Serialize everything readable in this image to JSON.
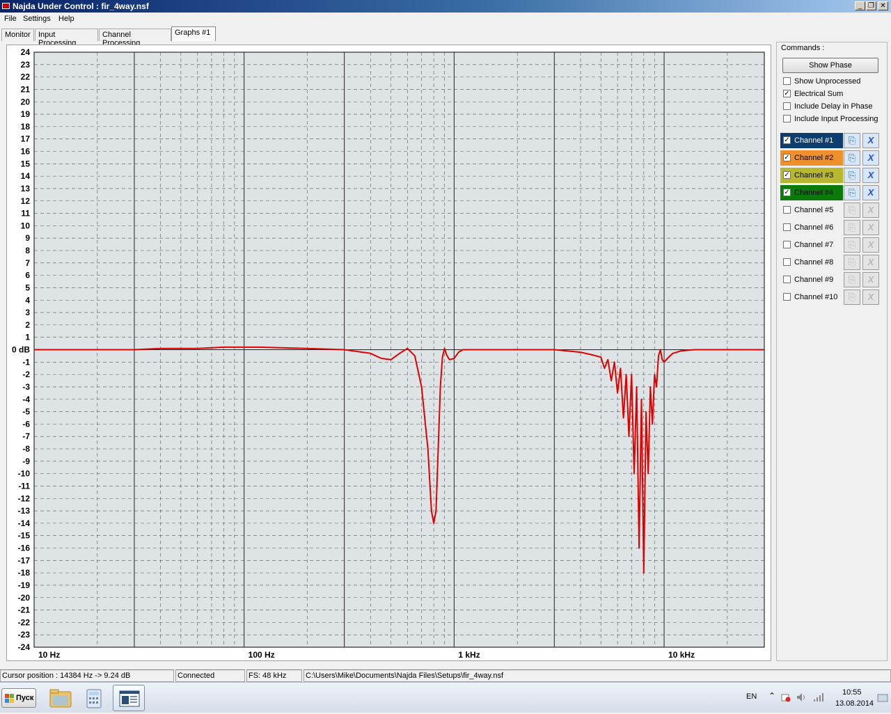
{
  "window": {
    "title": "Najda Under Control : fir_4way.nsf",
    "minimize": "_",
    "restore": "❐",
    "close": "✕"
  },
  "menu": [
    "File",
    "Settings",
    "Help"
  ],
  "tabs": [
    {
      "label": "Monitor",
      "active": false
    },
    {
      "label": "Input Processing",
      "active": false
    },
    {
      "label": "Channel Processing",
      "active": false
    },
    {
      "label": "Graphs #1",
      "active": true
    }
  ],
  "graph": {
    "chart_data": {
      "type": "line",
      "xscale": "log",
      "xlim": [
        10,
        30000
      ],
      "ylim": [
        -24,
        24
      ],
      "ylabel_unit": "dB",
      "yticks": [
        24,
        23,
        22,
        21,
        20,
        19,
        18,
        17,
        16,
        15,
        14,
        13,
        12,
        11,
        10,
        9,
        8,
        7,
        6,
        5,
        4,
        3,
        2,
        1,
        0,
        -1,
        -2,
        -3,
        -4,
        -5,
        -6,
        -7,
        -8,
        -9,
        -10,
        -11,
        -12,
        -13,
        -14,
        -15,
        -16,
        -17,
        -18,
        -19,
        -20,
        -21,
        -22,
        -23,
        -24
      ],
      "ytick_labels": [
        "24",
        "23",
        "22",
        "21",
        "20",
        "19",
        "18",
        "17",
        "16",
        "15",
        "14",
        "13",
        "12",
        "11",
        "10",
        "9",
        "8",
        "7",
        "6",
        "5",
        "4",
        "3",
        "2",
        "1",
        "0 dB",
        "-1",
        "-2",
        "-3",
        "-4",
        "-5",
        "-6",
        "-7",
        "-8",
        "-9",
        "-10",
        "-11",
        "-12",
        "-13",
        "-14",
        "-15",
        "-16",
        "-17",
        "-18",
        "-19",
        "-20",
        "-21",
        "-22",
        "-23",
        "-24"
      ],
      "xticks": [
        {
          "value": 10,
          "label": "10 Hz"
        },
        {
          "value": 100,
          "label": "100 Hz"
        },
        {
          "value": 1000,
          "label": "1 kHz"
        },
        {
          "value": 10000,
          "label": "10 kHz"
        }
      ],
      "grid": true,
      "series": [
        {
          "color": "#e00000",
          "x": [
            10,
            30,
            40,
            60,
            80,
            100,
            120,
            200,
            300,
            400,
            450,
            500,
            550,
            600,
            650,
            700,
            750,
            780,
            800,
            820,
            840,
            860,
            880,
            900,
            920,
            950,
            1000,
            1050,
            1100,
            1200,
            1300,
            1500,
            2000,
            3000,
            4000,
            4500,
            5000,
            5200,
            5400,
            5600,
            5800,
            6000,
            6200,
            6400,
            6600,
            6800,
            7000,
            7200,
            7400,
            7600,
            7800,
            8000,
            8200,
            8400,
            8600,
            8800,
            9000,
            9200,
            9400,
            9600,
            9800,
            10000,
            10500,
            11000,
            12000,
            14000,
            16000,
            20000,
            25000,
            30000
          ],
          "y": [
            0,
            0,
            0.1,
            0.1,
            0.2,
            0.2,
            0.2,
            0.1,
            0,
            -0.3,
            -0.7,
            -0.8,
            -0.3,
            0.1,
            -0.5,
            -3,
            -8,
            -13,
            -14,
            -13,
            -8,
            -3,
            -0.6,
            0.1,
            -0.4,
            -0.8,
            -0.7,
            -0.2,
            0,
            0,
            0,
            0,
            0,
            0,
            -0.2,
            -0.4,
            -0.6,
            -1.5,
            -0.8,
            -2.5,
            -1,
            -3.5,
            -1.5,
            -5.5,
            -2,
            -7,
            -2,
            -10,
            -3,
            -16,
            -4,
            -18,
            -5,
            -10,
            -3,
            -6,
            -2,
            -3,
            -0.5,
            0,
            -0.8,
            -1,
            -0.6,
            -0.3,
            -0.1,
            0,
            0,
            0,
            0,
            0
          ]
        }
      ]
    }
  },
  "commands": {
    "title": "Commands :",
    "show_phase_label": "Show Phase",
    "options": [
      {
        "label": "Show Unprocessed",
        "checked": false
      },
      {
        "label": "Electrical Sum",
        "checked": true
      },
      {
        "label": "Include Delay in Phase",
        "checked": false
      },
      {
        "label": "Include Input Processing",
        "checked": false
      }
    ],
    "channels": [
      {
        "label": "Channel #1",
        "checked": true,
        "color": "#0b3e6e",
        "text_color": "#ffffff",
        "enabled": true
      },
      {
        "label": "Channel #2",
        "checked": true,
        "color": "#f0902a",
        "text_color": "#000000",
        "enabled": true
      },
      {
        "label": "Channel #3",
        "checked": true,
        "color": "#b8b830",
        "text_color": "#000000",
        "enabled": true
      },
      {
        "label": "Channel #4",
        "checked": true,
        "color": "#0a7a0a",
        "text_color": "#000000",
        "enabled": true
      },
      {
        "label": "Channel #5",
        "checked": false,
        "color": "",
        "text_color": "#000000",
        "enabled": false
      },
      {
        "label": "Channel #6",
        "checked": false,
        "color": "",
        "text_color": "#000000",
        "enabled": false
      },
      {
        "label": "Channel #7",
        "checked": false,
        "color": "",
        "text_color": "#000000",
        "enabled": false
      },
      {
        "label": "Channel #8",
        "checked": false,
        "color": "",
        "text_color": "#000000",
        "enabled": false
      },
      {
        "label": "Channel #9",
        "checked": false,
        "color": "",
        "text_color": "#000000",
        "enabled": false
      },
      {
        "label": "Channel #10",
        "checked": false,
        "color": "",
        "text_color": "#000000",
        "enabled": false
      }
    ]
  },
  "status": {
    "cursor": "Cursor position : 14384 Hz -> 9.24 dB",
    "connection": "Connected",
    "fs": "FS: 48 kHz",
    "path": "C:\\Users\\Mike\\Documents\\Najda Files\\Setups\\fir_4way.nsf"
  },
  "taskbar": {
    "start_label": "Пуск",
    "apps": [
      "explorer-icon",
      "calculator-icon",
      "najda-app-icon"
    ],
    "language": "EN",
    "time": "10:55",
    "date": "13.08.2014"
  }
}
